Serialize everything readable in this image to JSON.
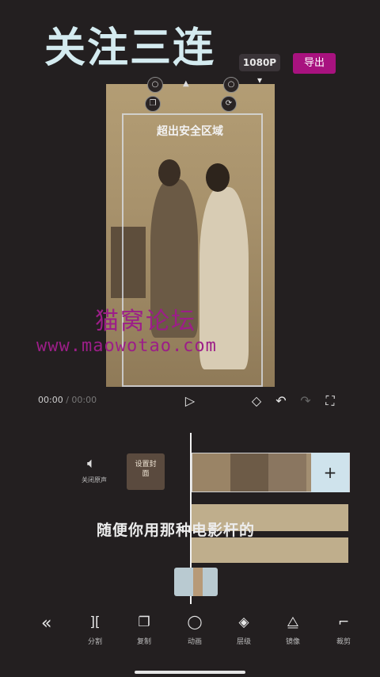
{
  "header": {
    "overlay_title": "关注三连",
    "resolution": "1080P",
    "export_label": "导出"
  },
  "preview": {
    "safe_zone_label": "超出安全区域"
  },
  "watermark": {
    "title": "猫窝论坛",
    "url": "www.maowotao.com"
  },
  "playback": {
    "current_time": "00:00",
    "total_time": "/ 00:00"
  },
  "timeline": {
    "mute_label": "关闭原声",
    "cover_label": "设置封面",
    "add_clip_symbol": "+",
    "caption": "随便你用那种电影杆的"
  },
  "toolbar": {
    "items": [
      {
        "label": "分割",
        "icon": "split-icon"
      },
      {
        "label": "复制",
        "icon": "copy-icon"
      },
      {
        "label": "动画",
        "icon": "animation-icon"
      },
      {
        "label": "层级",
        "icon": "layers-icon"
      },
      {
        "label": "镜像",
        "icon": "mirror-icon"
      },
      {
        "label": "裁剪",
        "icon": "crop-icon"
      }
    ]
  },
  "colors": {
    "accent": "#a8127f",
    "background": "#231f20",
    "watermark": "#9c1e88"
  }
}
